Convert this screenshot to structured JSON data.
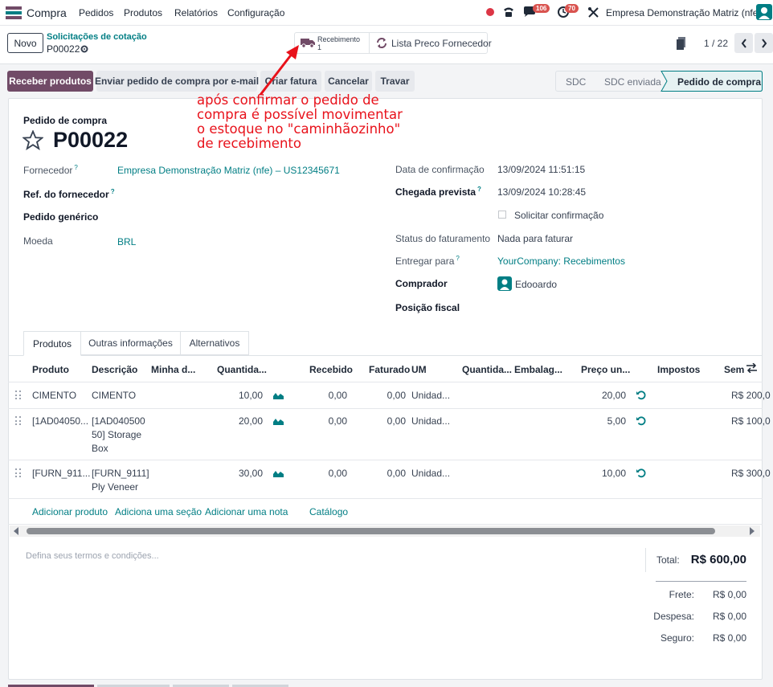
{
  "nav": {
    "app_name": "Compra",
    "menu": [
      "Pedidos",
      "Produtos",
      "Relatórios",
      "Configuração"
    ],
    "messages_count": "106",
    "activities_count": "70",
    "company": "Empresa Demonstração Matriz (nfe)"
  },
  "control": {
    "new_label": "Novo",
    "breadcrumb": "Solicitações de cotação",
    "record": "P00022",
    "receipt_label": "Recebimento",
    "receipt_count": "1",
    "pricelist_label": "Lista Preco Fornecedor",
    "pager": "1 / 22"
  },
  "actions": {
    "buttons": [
      "Receber produtos",
      "Enviar pedido de compra por e-mail",
      "Criar fatura",
      "Cancelar",
      "Travar"
    ],
    "stages": [
      "SDC",
      "SDC enviada",
      "Pedido de compra"
    ]
  },
  "annotation": {
    "text_lines": [
      "após confirmar o pedido de",
      "compra é possível movimentar",
      "o estoque no \"caminhãozinho\"",
      "de recebimento"
    ],
    "color": "#e8121b"
  },
  "form": {
    "doc_type": "Pedido de compra",
    "doc_name": "P00022",
    "left": [
      {
        "label": "Fornecedor",
        "hint": "?",
        "value": "Empresa Demonstração Matriz (nfe) – US12345671",
        "style": "muted",
        "link": true
      },
      {
        "label": "Ref. do fornecedor",
        "hint": "?",
        "value": "",
        "style": "bold",
        "link": false
      },
      {
        "label": "Pedido genérico",
        "hint": "",
        "value": "",
        "style": "bold",
        "link": false
      },
      {
        "label": "Moeda",
        "hint": "",
        "value": "BRL",
        "style": "muted",
        "link": true
      }
    ],
    "right": [
      {
        "label": "Data de confirmação",
        "hint": "",
        "value": "13/09/2024 11:51:15",
        "style": "muted"
      },
      {
        "label": "Chegada prevista",
        "hint": "?",
        "value": "13/09/2024 10:28:45",
        "style": "bold"
      },
      {
        "label": "",
        "hint": "",
        "value": "Solicitar confirmação",
        "style": "checkbox"
      },
      {
        "label": "Status do faturamento",
        "hint": "",
        "value": "Nada para faturar",
        "style": "muted"
      },
      {
        "label": "Entregar para",
        "hint": "?",
        "value": "YourCompany: Recebimentos",
        "style": "muted",
        "link": true
      },
      {
        "label": "Comprador",
        "hint": "",
        "value": "Edooardo",
        "style": "bold",
        "avatar": true
      },
      {
        "label": "Posição fiscal",
        "hint": "",
        "value": "",
        "style": "bold"
      }
    ]
  },
  "tabs": [
    "Produtos",
    "Outras informações",
    "Alternativos"
  ],
  "table": {
    "headers": [
      "Produto",
      "Descrição",
      "Minha d...",
      "Quantida...",
      "Recebido",
      "Faturado",
      "UM",
      "Quantida...",
      "Embalag...",
      "Preço un...",
      "Impostos",
      "Sem"
    ],
    "rows": [
      {
        "produto": "CIMENTO",
        "descricao": [
          "CIMENTO"
        ],
        "quantidade": "10,00",
        "recebido": "0,00",
        "faturado": "0,00",
        "um": "Unidad...",
        "preco": "20,00",
        "subtotal": "R$ 200,0"
      },
      {
        "produto": "[1AD04050...",
        "descricao": [
          "[1AD040500",
          "50] Storage",
          "Box"
        ],
        "quantidade": "20,00",
        "recebido": "0,00",
        "faturado": "0,00",
        "um": "Unidad...",
        "preco": "5,00",
        "subtotal": "R$ 100,0"
      },
      {
        "produto": "[FURN_911...",
        "descricao": [
          "[FURN_9111]",
          "Ply Veneer"
        ],
        "quantidade": "30,00",
        "recebido": "0,00",
        "faturado": "0,00",
        "um": "Unidad...",
        "preco": "10,00",
        "subtotal": "R$ 300,0"
      }
    ],
    "add_links": [
      "Adicionar produto",
      "Adiciona uma seção",
      "Adicionar uma nota",
      "Catálogo"
    ]
  },
  "footer": {
    "terms_placeholder": "Defina seus termos e condições...",
    "total_label": "Total:",
    "total_value": "R$ 600,00",
    "extra": [
      {
        "label": "Frete:",
        "value": "R$ 0,00"
      },
      {
        "label": "Despesa:",
        "value": "R$ 0,00"
      },
      {
        "label": "Seguro:",
        "value": "R$ 0,00"
      }
    ]
  },
  "colors": {
    "primary": "#714b67",
    "accent": "#017e84",
    "annotation": "#e8121b"
  }
}
